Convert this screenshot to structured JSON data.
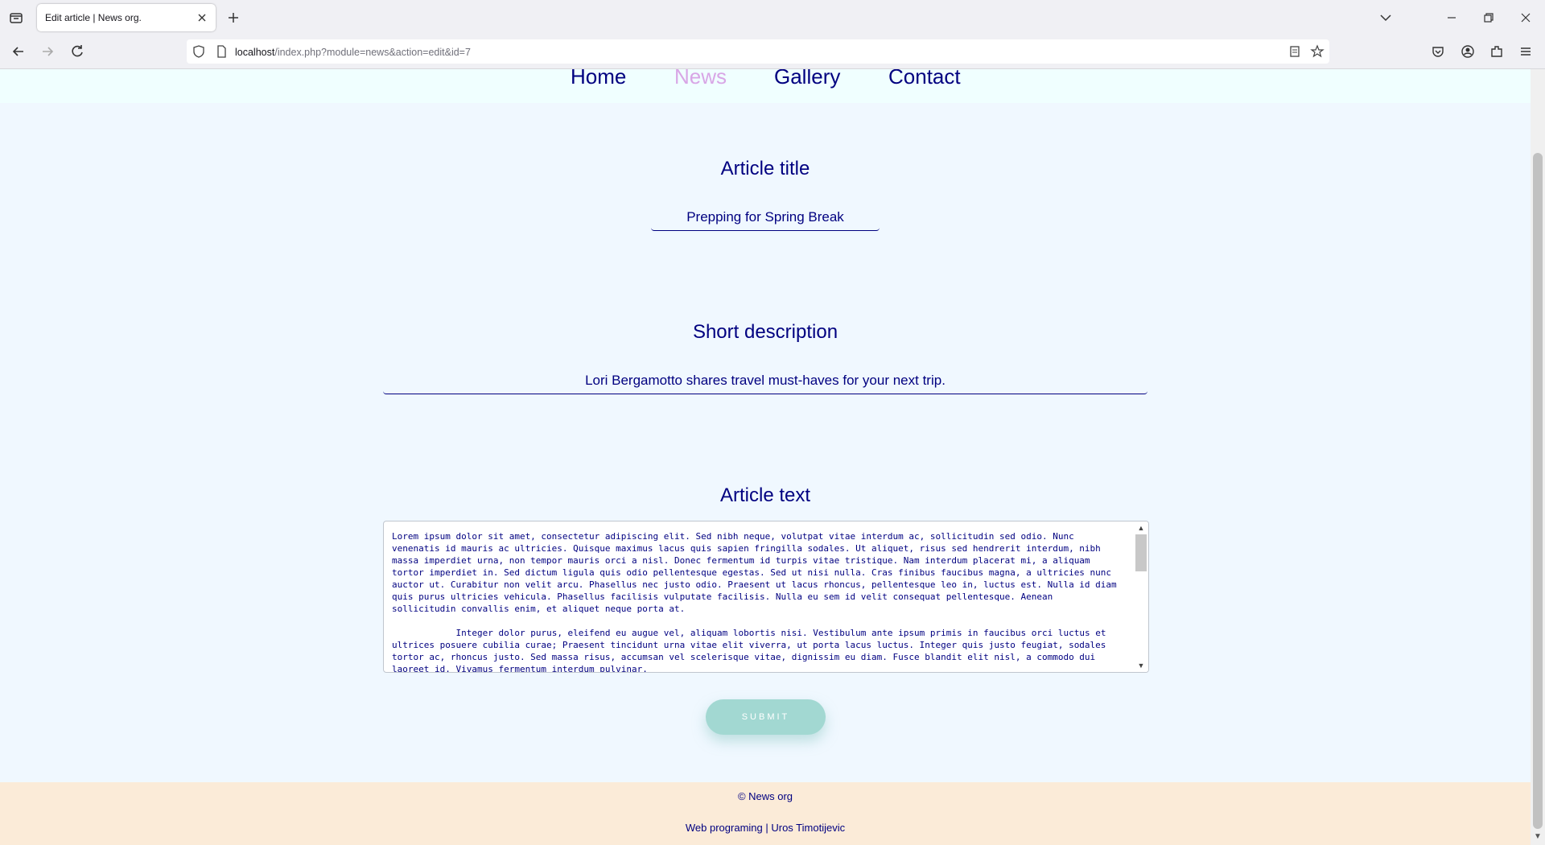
{
  "browser": {
    "tab_title": "Edit article | News org.",
    "url_host": "localhost",
    "url_path": "/index.php?module=news&action=edit&id=7"
  },
  "site_nav": {
    "items": [
      {
        "label": "Home",
        "active": false
      },
      {
        "label": "News",
        "active": true
      },
      {
        "label": "Gallery",
        "active": false
      },
      {
        "label": "Contact",
        "active": false
      }
    ]
  },
  "form": {
    "title_label": "Article title",
    "title_value": "Prepping for Spring Break",
    "description_label": "Short description",
    "description_value": "Lori Bergamotto shares travel must-haves for your next trip.",
    "text_label": "Article text",
    "text_value": "Lorem ipsum dolor sit amet, consectetur adipiscing elit. Sed nibh neque, volutpat vitae interdum ac, sollicitudin sed odio. Nunc venenatis id mauris ac ultricies. Quisque maximus lacus quis sapien fringilla sodales. Ut aliquet, risus sed hendrerit interdum, nibh massa imperdiet urna, non tempor mauris orci a nisl. Donec fermentum id turpis vitae tristique. Nam interdum placerat mi, a aliquam tortor imperdiet in. Sed dictum ligula quis odio pellentesque egestas. Sed ut nisi nulla. Cras finibus faucibus magna, a ultricies nunc auctor ut. Curabitur non velit arcu. Phasellus nec justo odio. Praesent ut lacus rhoncus, pellentesque leo in, luctus est. Nulla id diam quis purus ultricies vehicula. Phasellus facilisis vulputate facilisis. Nulla eu sem id velit consequat pellentesque. Aenean sollicitudin convallis enim, et aliquet neque porta at.\n\n            Integer dolor purus, eleifend eu augue vel, aliquam lobortis nisi. Vestibulum ante ipsum primis in faucibus orci luctus et ultrices posuere cubilia curae; Praesent tincidunt urna vitae elit viverra, ut porta lacus luctus. Integer quis justo feugiat, sodales tortor ac, rhoncus justo. Sed massa risus, accumsan vel scelerisque vitae, dignissim eu diam. Fusce blandit elit nisl, a commodo dui laoreet id. Vivamus fermentum interdum pulvinar.",
    "submit_label": "SUBMIT"
  },
  "footer": {
    "copyright": "© News org",
    "credit": "Web programing | Uros Timotijevic"
  },
  "colors": {
    "accent": "#000080",
    "active_nav": "#d8a6e6",
    "submit_bg": "#a2d8d2",
    "footer_bg": "#fbebd8",
    "page_bg": "#f0f8ff"
  }
}
